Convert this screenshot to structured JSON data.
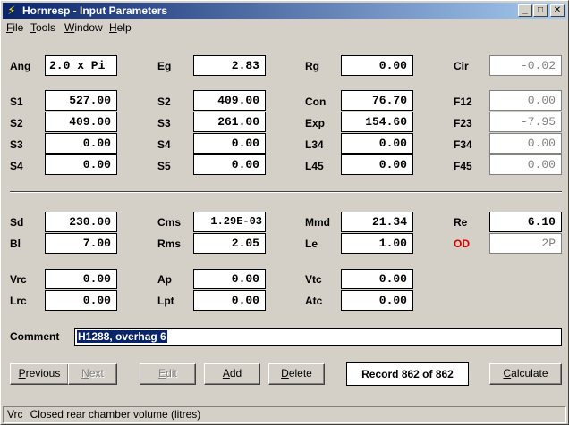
{
  "window": {
    "title": "Hornresp - Input Parameters",
    "minimize": "_",
    "maximize": "□",
    "close": "✕"
  },
  "menu": [
    {
      "accel": "F",
      "rest": "ile"
    },
    {
      "accel": "T",
      "rest": "ools"
    },
    {
      "accel": "W",
      "rest": "indow"
    },
    {
      "accel": "H",
      "rest": "elp"
    }
  ],
  "params": {
    "ang": {
      "label": "Ang",
      "value": "2.0 x Pi"
    },
    "eg": {
      "label": "Eg",
      "value": "2.83"
    },
    "rg": {
      "label": "Rg",
      "value": "0.00"
    },
    "cir": {
      "label": "Cir",
      "value": "-0.02"
    },
    "s1": {
      "label": "S1",
      "value": "527.00"
    },
    "s2a": {
      "label": "S2",
      "value": "409.00"
    },
    "s3a": {
      "label": "S3",
      "value": "0.00"
    },
    "s4a": {
      "label": "S4",
      "value": "0.00"
    },
    "s2b": {
      "label": "S2",
      "value": "409.00"
    },
    "s3b": {
      "label": "S3",
      "value": "261.00"
    },
    "s4b": {
      "label": "S4",
      "value": "0.00"
    },
    "s5": {
      "label": "S5",
      "value": "0.00"
    },
    "con": {
      "label": "Con",
      "value": "76.70"
    },
    "exp": {
      "label": "Exp",
      "value": "154.60"
    },
    "l34": {
      "label": "L34",
      "value": "0.00"
    },
    "l45": {
      "label": "L45",
      "value": "0.00"
    },
    "f12": {
      "label": "F12",
      "value": "0.00"
    },
    "f23": {
      "label": "F23",
      "value": "-7.95"
    },
    "f34": {
      "label": "F34",
      "value": "0.00"
    },
    "f45": {
      "label": "F45",
      "value": "0.00"
    },
    "sd": {
      "label": "Sd",
      "value": "230.00"
    },
    "bl": {
      "label": "Bl",
      "value": "7.00"
    },
    "cms": {
      "label": "Cms",
      "value": "1.29E-03"
    },
    "rms": {
      "label": "Rms",
      "value": "2.05"
    },
    "mmd": {
      "label": "Mmd",
      "value": "21.34"
    },
    "le": {
      "label": "Le",
      "value": "1.00"
    },
    "re": {
      "label": "Re",
      "value": "6.10"
    },
    "od": {
      "label": "OD",
      "value": "2P"
    },
    "vrc": {
      "label": "Vrc",
      "value": "0.00"
    },
    "lrc": {
      "label": "Lrc",
      "value": "0.00"
    },
    "ap": {
      "label": "Ap",
      "value": "0.00"
    },
    "lpt": {
      "label": "Lpt",
      "value": "0.00"
    },
    "vtc": {
      "label": "Vtc",
      "value": "0.00"
    },
    "atc": {
      "label": "Atc",
      "value": "0.00"
    }
  },
  "comment": {
    "label": "Comment",
    "value": "H1288, overhag 6"
  },
  "buttons": {
    "previous": {
      "accel": "P",
      "rest": "revious"
    },
    "next": {
      "accel": "N",
      "rest": "ext"
    },
    "edit": {
      "accel": "E",
      "rest": "dit"
    },
    "add": {
      "accel": "A",
      "rest": "dd"
    },
    "delete": {
      "accel": "D",
      "rest": "elete"
    },
    "calculate": {
      "accel": "C",
      "rest": "alculate"
    }
  },
  "record": "Record 862 of 862",
  "status": {
    "field": "Vrc",
    "text": "Closed rear chamber volume  (litres)"
  },
  "colors": {
    "title_start": "#0a246a",
    "title_end": "#a6caf0",
    "face": "#d4d0c8",
    "od_label": "#d40000"
  }
}
